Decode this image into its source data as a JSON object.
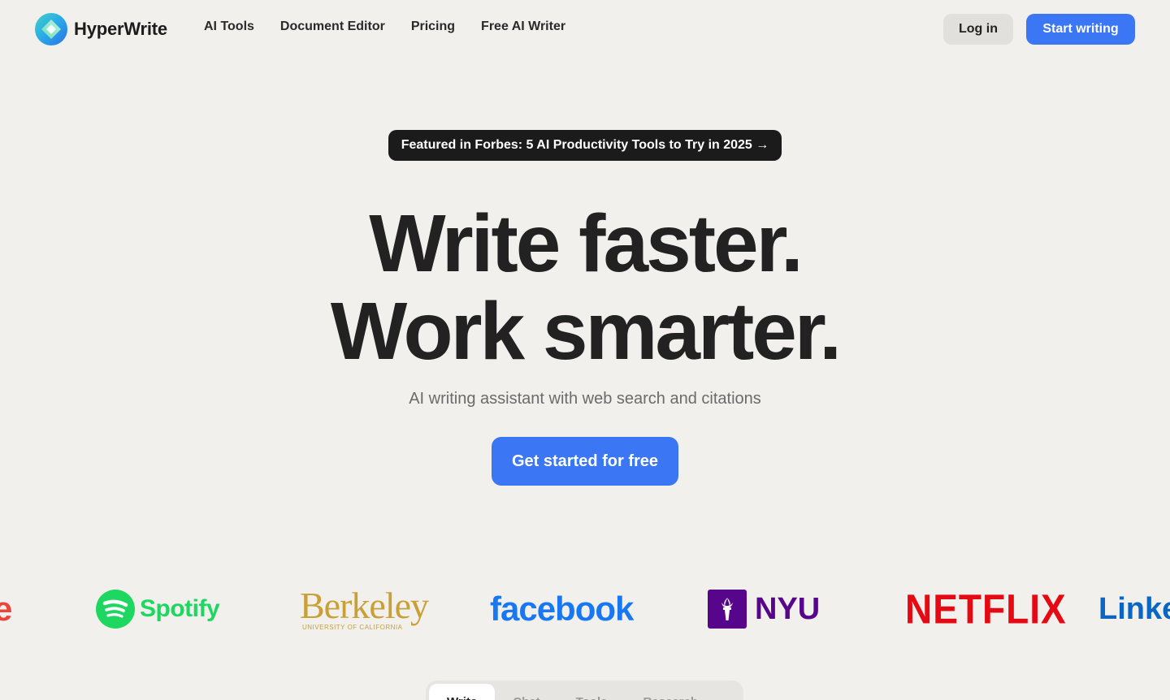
{
  "nav": {
    "brand": "HyperWrite",
    "links": [
      "AI Tools",
      "Document Editor",
      "Pricing",
      "Free AI Writer"
    ],
    "login": "Log in",
    "start": "Start writing"
  },
  "hero": {
    "badge": "Featured in Forbes: 5 AI Productivity Tools to Try in 2025 →",
    "headline_line1": "Write faster.",
    "headline_line2": "Work smarter.",
    "subhead": "AI writing assistant with web search and citations",
    "cta": "Get started for free"
  },
  "logos": {
    "partial_left": "e",
    "spotify": "Spotify",
    "berkeley": "Berkeley",
    "berkeley_sub": "UNIVERSITY OF CALIFORNIA",
    "facebook": "facebook",
    "nyu": "NYU",
    "netflix": "NETFLIX",
    "linkedin_partial": "Linke"
  },
  "tabs": [
    "Write",
    "Chat",
    "Tools",
    "Research"
  ],
  "colors": {
    "background": "#f2f0ed",
    "accent": "#3b76f5",
    "badge": "#1b1b1b",
    "spotify": "#1ed760",
    "berkeley": "#c8a037",
    "facebook": "#1877f2",
    "nyu": "#57068c",
    "netflix": "#e50914",
    "linkedin": "#0a66c2"
  },
  "icons": {
    "brand": "hyperwrite-logo-icon",
    "spotify": "spotify-icon",
    "nyu": "nyu-torch-icon"
  }
}
